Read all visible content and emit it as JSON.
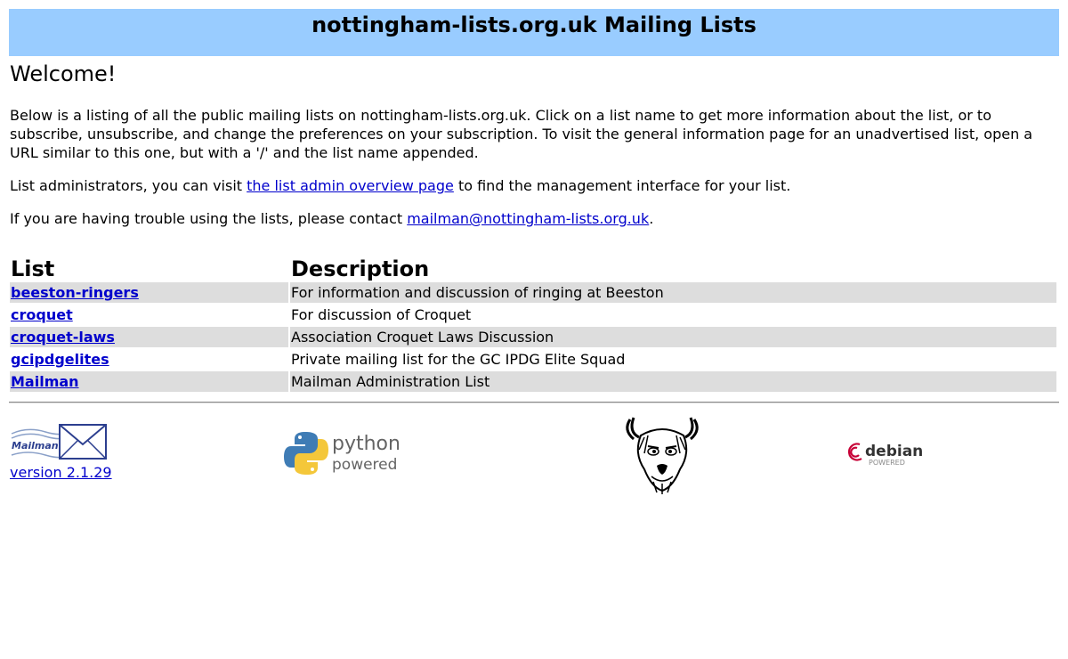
{
  "header": {
    "title": "nottingham-lists.org.uk Mailing Lists"
  },
  "intro": {
    "welcome": "Welcome!",
    "description": "Below is a listing of all the public mailing lists on nottingham-lists.org.uk. Click on a list name to get more information about the list, or to subscribe, unsubscribe, and change the preferences on your subscription. To visit the general information page for an unadvertised list, open a URL similar to this one, but with a '/' and the list name appended.",
    "admin_prefix": "List administrators, you can visit ",
    "admin_link": "the list admin overview page",
    "admin_suffix": " to find the management interface for your list.",
    "contact_prefix": "If you are having trouble using the lists, please contact ",
    "contact_email": "mailman@nottingham-lists.org.uk",
    "contact_suffix": "."
  },
  "table": {
    "headers": {
      "list": "List",
      "description": "Description"
    },
    "rows": [
      {
        "name": "beeston-ringers",
        "description": "For information and discussion of ringing at Beeston"
      },
      {
        "name": "croquet",
        "description": "For discussion of Croquet"
      },
      {
        "name": "croquet-laws",
        "description": "Association Croquet Laws Discussion"
      },
      {
        "name": "gcipdgelites",
        "description": "Private mailing list for the GC IPDG Elite Squad"
      },
      {
        "name": "Mailman",
        "description": "Mailman Administration List"
      }
    ]
  },
  "footer": {
    "mailman_logo_text": "Mailman",
    "mailman_version": "version 2.1.29",
    "python_word": "python",
    "python_powered": "powered",
    "debian_word": "debian",
    "debian_powered": "POWERED"
  },
  "colors": {
    "banner": "#99ccff",
    "row_shade": "#dddddd",
    "link": "#0000cc"
  },
  "icons": [
    "mailman-logo-icon",
    "python-powered-logo-icon",
    "gnu-head-logo-icon",
    "debian-powered-logo-icon"
  ]
}
